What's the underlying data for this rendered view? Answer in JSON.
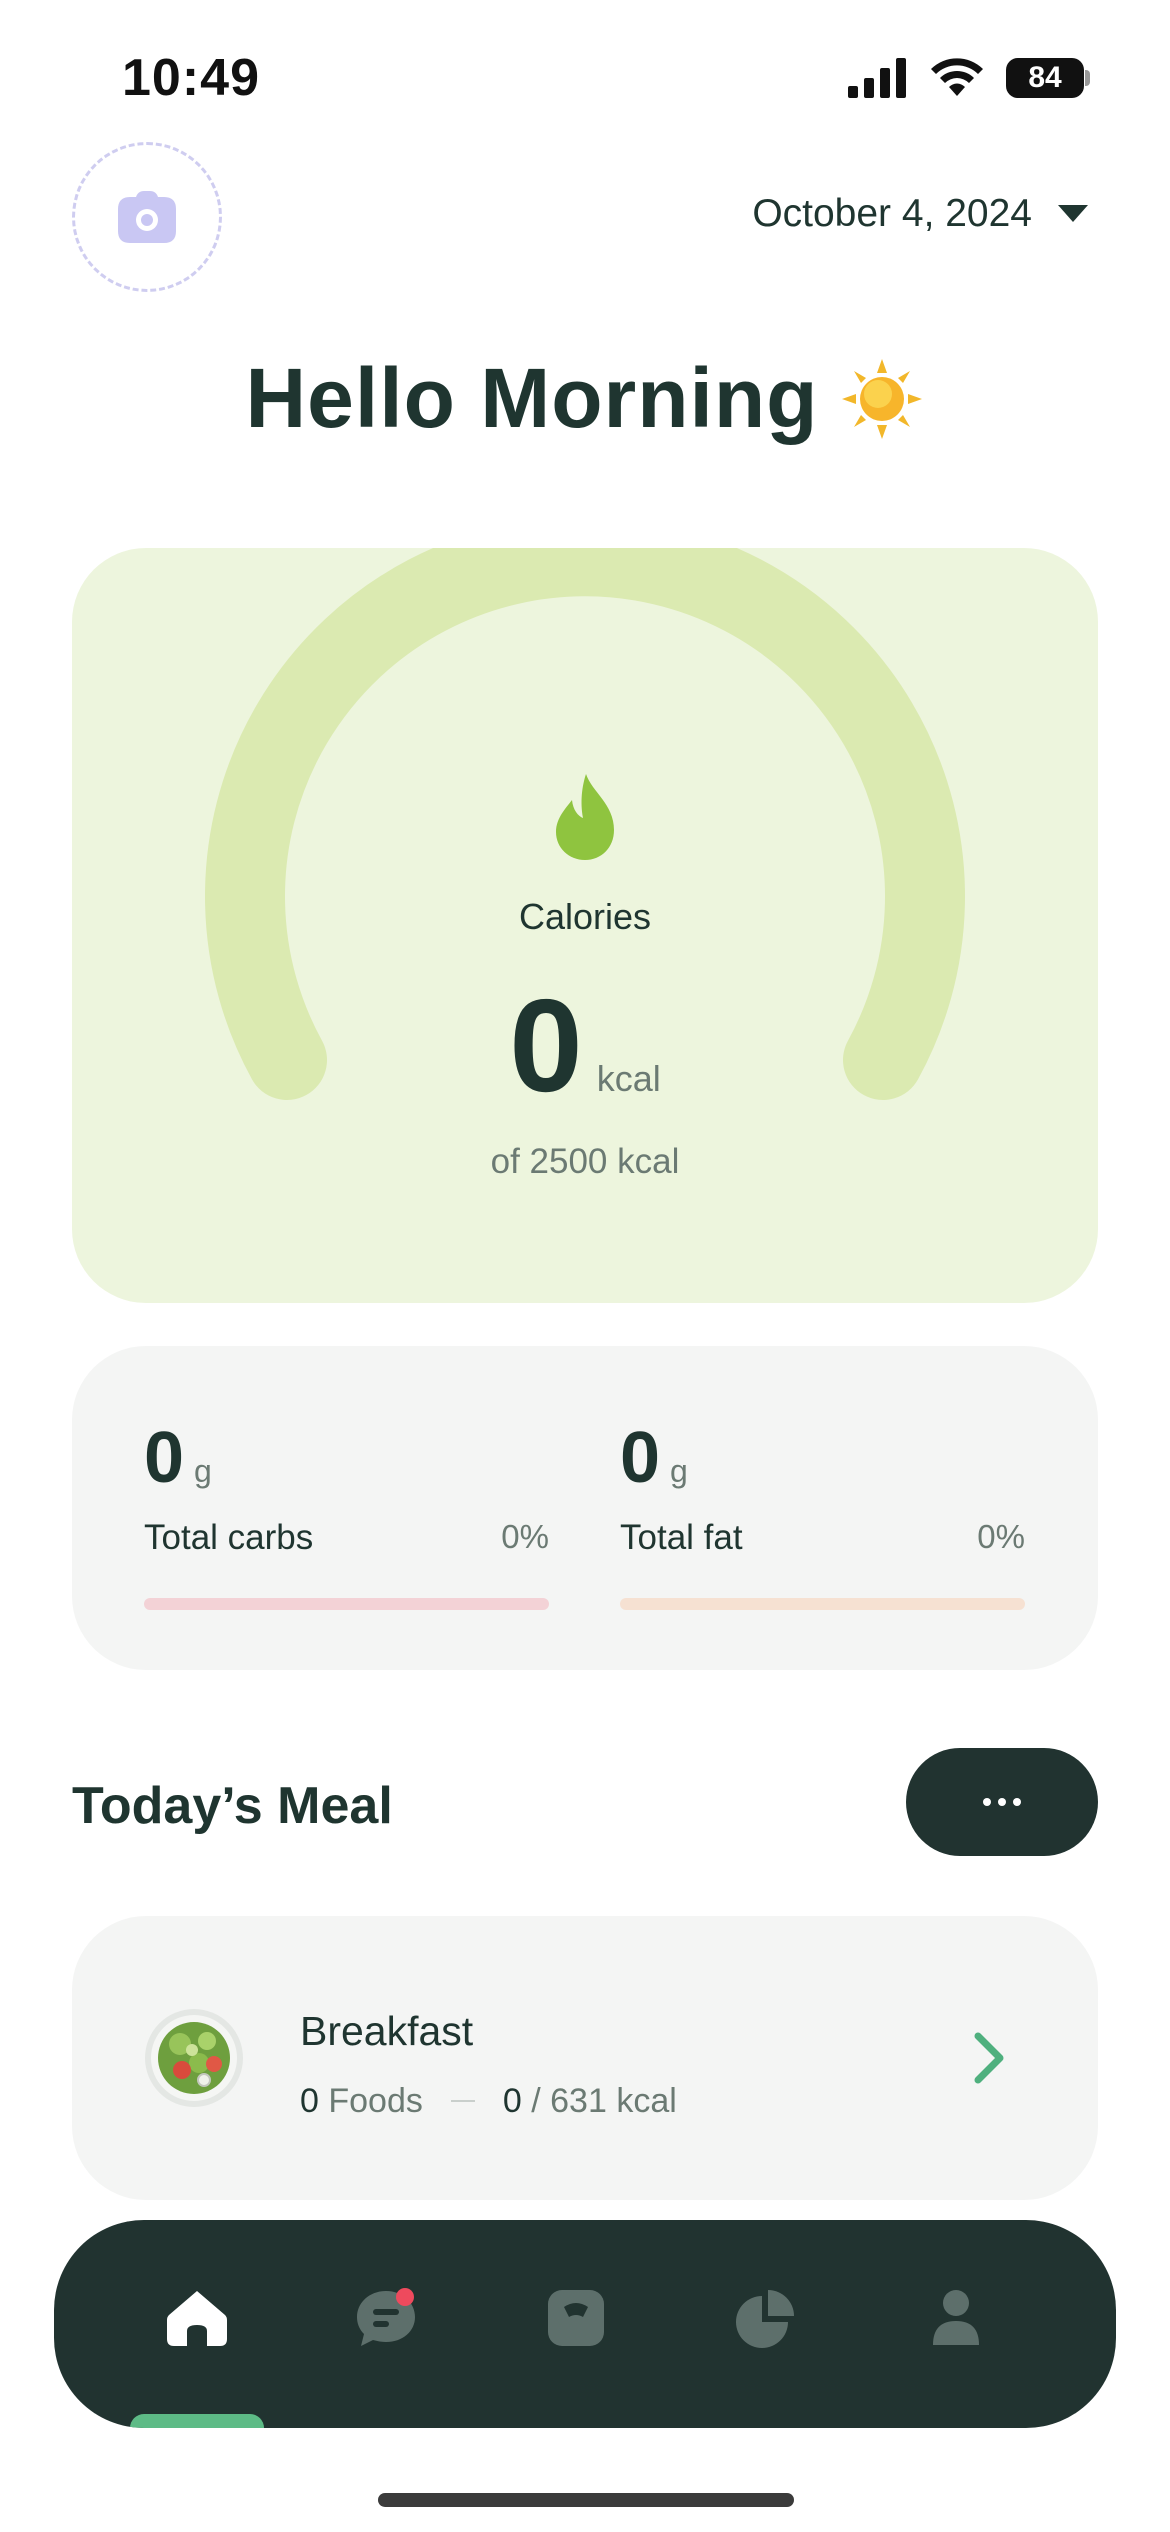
{
  "status_bar": {
    "time": "10:49",
    "battery_pct": "84"
  },
  "header": {
    "date": "October 4, 2024",
    "avatar_icon": "camera-icon",
    "date_chevron_icon": "caret-down-icon"
  },
  "greeting": {
    "text": "Hello Morning",
    "emoji": "sun-icon"
  },
  "calories": {
    "icon": "flame-icon",
    "label": "Calories",
    "value": "0",
    "unit": "kcal",
    "goal_text": "of 2500 kcal",
    "progress": 0
  },
  "macros": [
    {
      "value": "0",
      "unit": "g",
      "name": "Total carbs",
      "percent": "0%",
      "track_color": "#f3d2d6",
      "progress": 0
    },
    {
      "value": "0",
      "unit": "g",
      "name": "Total fat",
      "percent": "0%",
      "track_color": "#f6e1d2",
      "progress": 0
    }
  ],
  "meals_section": {
    "title": "Today’s Meal",
    "more_icon": "more-dots-icon"
  },
  "meals": [
    {
      "name": "Breakfast",
      "foods_count": "0",
      "foods_label": "Foods",
      "kcal_value": "0",
      "kcal_goal": "/ 631 kcal",
      "icon": "salad-icon"
    }
  ],
  "tabbar": {
    "active_tab": "home",
    "tabs": [
      {
        "id": "home",
        "icon": "home-icon"
      },
      {
        "id": "chat",
        "icon": "chat-icon",
        "badge": true
      },
      {
        "id": "scale",
        "icon": "scale-icon"
      },
      {
        "id": "stats",
        "icon": "pie-chart-icon"
      },
      {
        "id": "profile",
        "icon": "user-icon"
      }
    ]
  },
  "colors": {
    "primary_dark": "#213330",
    "calorie_card_bg": "#edf5dd",
    "gauge_track": "#dbeab1",
    "flame": "#8fc43f",
    "accent_green": "#5dbb86",
    "badge_red": "#ee4a5d"
  }
}
